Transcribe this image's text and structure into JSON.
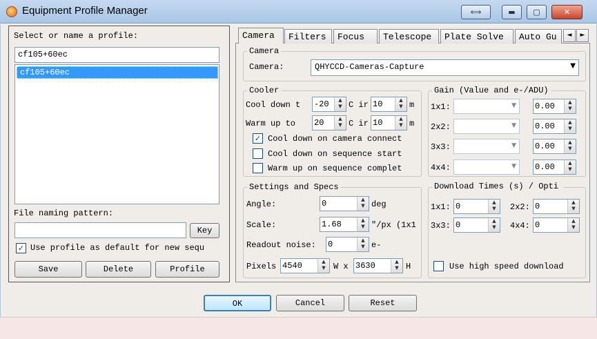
{
  "window": {
    "title": "Equipment Profile Manager",
    "restore_glyph": "⟺",
    "min_glyph": "▬",
    "max_glyph": "▢",
    "close_glyph": "✕"
  },
  "left": {
    "select_label": "Select or name a profile:",
    "profile_input": "cf105+60ec",
    "profiles": [
      "cf105+60ec"
    ],
    "naming_label": "File naming pattern:",
    "naming_value": "",
    "key_button": "Key",
    "default_label": "Use profile as default for new sequ",
    "default_checked": "✓",
    "save_button": "Save",
    "delete_button": "Delete",
    "profile_button": "Profile"
  },
  "tabs": {
    "items": [
      "Camera",
      "Filters",
      "Focus",
      "Telescope",
      "Plate Solve",
      "Auto Gu"
    ],
    "scroll_left": "◄",
    "scroll_right": "►"
  },
  "camera": {
    "group_label": "Camera",
    "label": "Camera:",
    "value": "QHYCCD-Cameras-Capture",
    "dropdown_glyph": "▼"
  },
  "cooler": {
    "group_label": "Cooler",
    "cool_label": "Cool down t",
    "cool_temp": "-20",
    "cool_unit": "C ir",
    "cool_minutes": "10",
    "cool_min_unit": "m",
    "warm_label": "Warm up to",
    "warm_temp": "20",
    "warm_unit": "C ir",
    "warm_minutes": "10",
    "warm_min_unit": "m",
    "opt_connect": "Cool down on camera connect",
    "opt_connect_checked": "✓",
    "opt_seq_start": "Cool down on sequence start",
    "opt_seq_complete": "Warm up on sequence complet"
  },
  "gain": {
    "group_label": "Gain (Value and e-/ADU)",
    "rows": [
      {
        "label": "1x1:",
        "eadu": "0.00"
      },
      {
        "label": "2x2:",
        "eadu": "0.00"
      },
      {
        "label": "3x3:",
        "eadu": "0.00"
      },
      {
        "label": "4x4:",
        "eadu": "0.00"
      }
    ]
  },
  "settings": {
    "group_label": "Settings and Specs",
    "angle_label": "Angle:",
    "angle_value": "0",
    "angle_unit": "deg",
    "scale_label": "Scale:",
    "scale_value": "1.68",
    "scale_unit": "\"/px (1x1",
    "noise_label": "Readout noise:",
    "noise_value": "0",
    "noise_unit": "e-",
    "pixels_label": "Pixels",
    "pixels_w": "4540",
    "pixels_w_unit": "W x",
    "pixels_h": "3630",
    "pixels_h_unit": "H"
  },
  "download": {
    "group_label": "Download Times (s) / Opti",
    "t1x1_label": "1x1:",
    "t1x1": "0",
    "t2x2_label": "2x2:",
    "t2x2": "0",
    "t3x3_label": "3x3:",
    "t3x3": "0",
    "t4x4_label": "4x4:",
    "t4x4": "0",
    "high_speed_label": "Use high speed download"
  },
  "footer": {
    "ok": "OK",
    "cancel": "Cancel",
    "reset": "Reset"
  },
  "spin_up": "▲",
  "spin_down": "▼",
  "colors": {
    "selection": "#3399ff",
    "close_button": "#c8452c",
    "titlebar": "#b6cfea"
  }
}
